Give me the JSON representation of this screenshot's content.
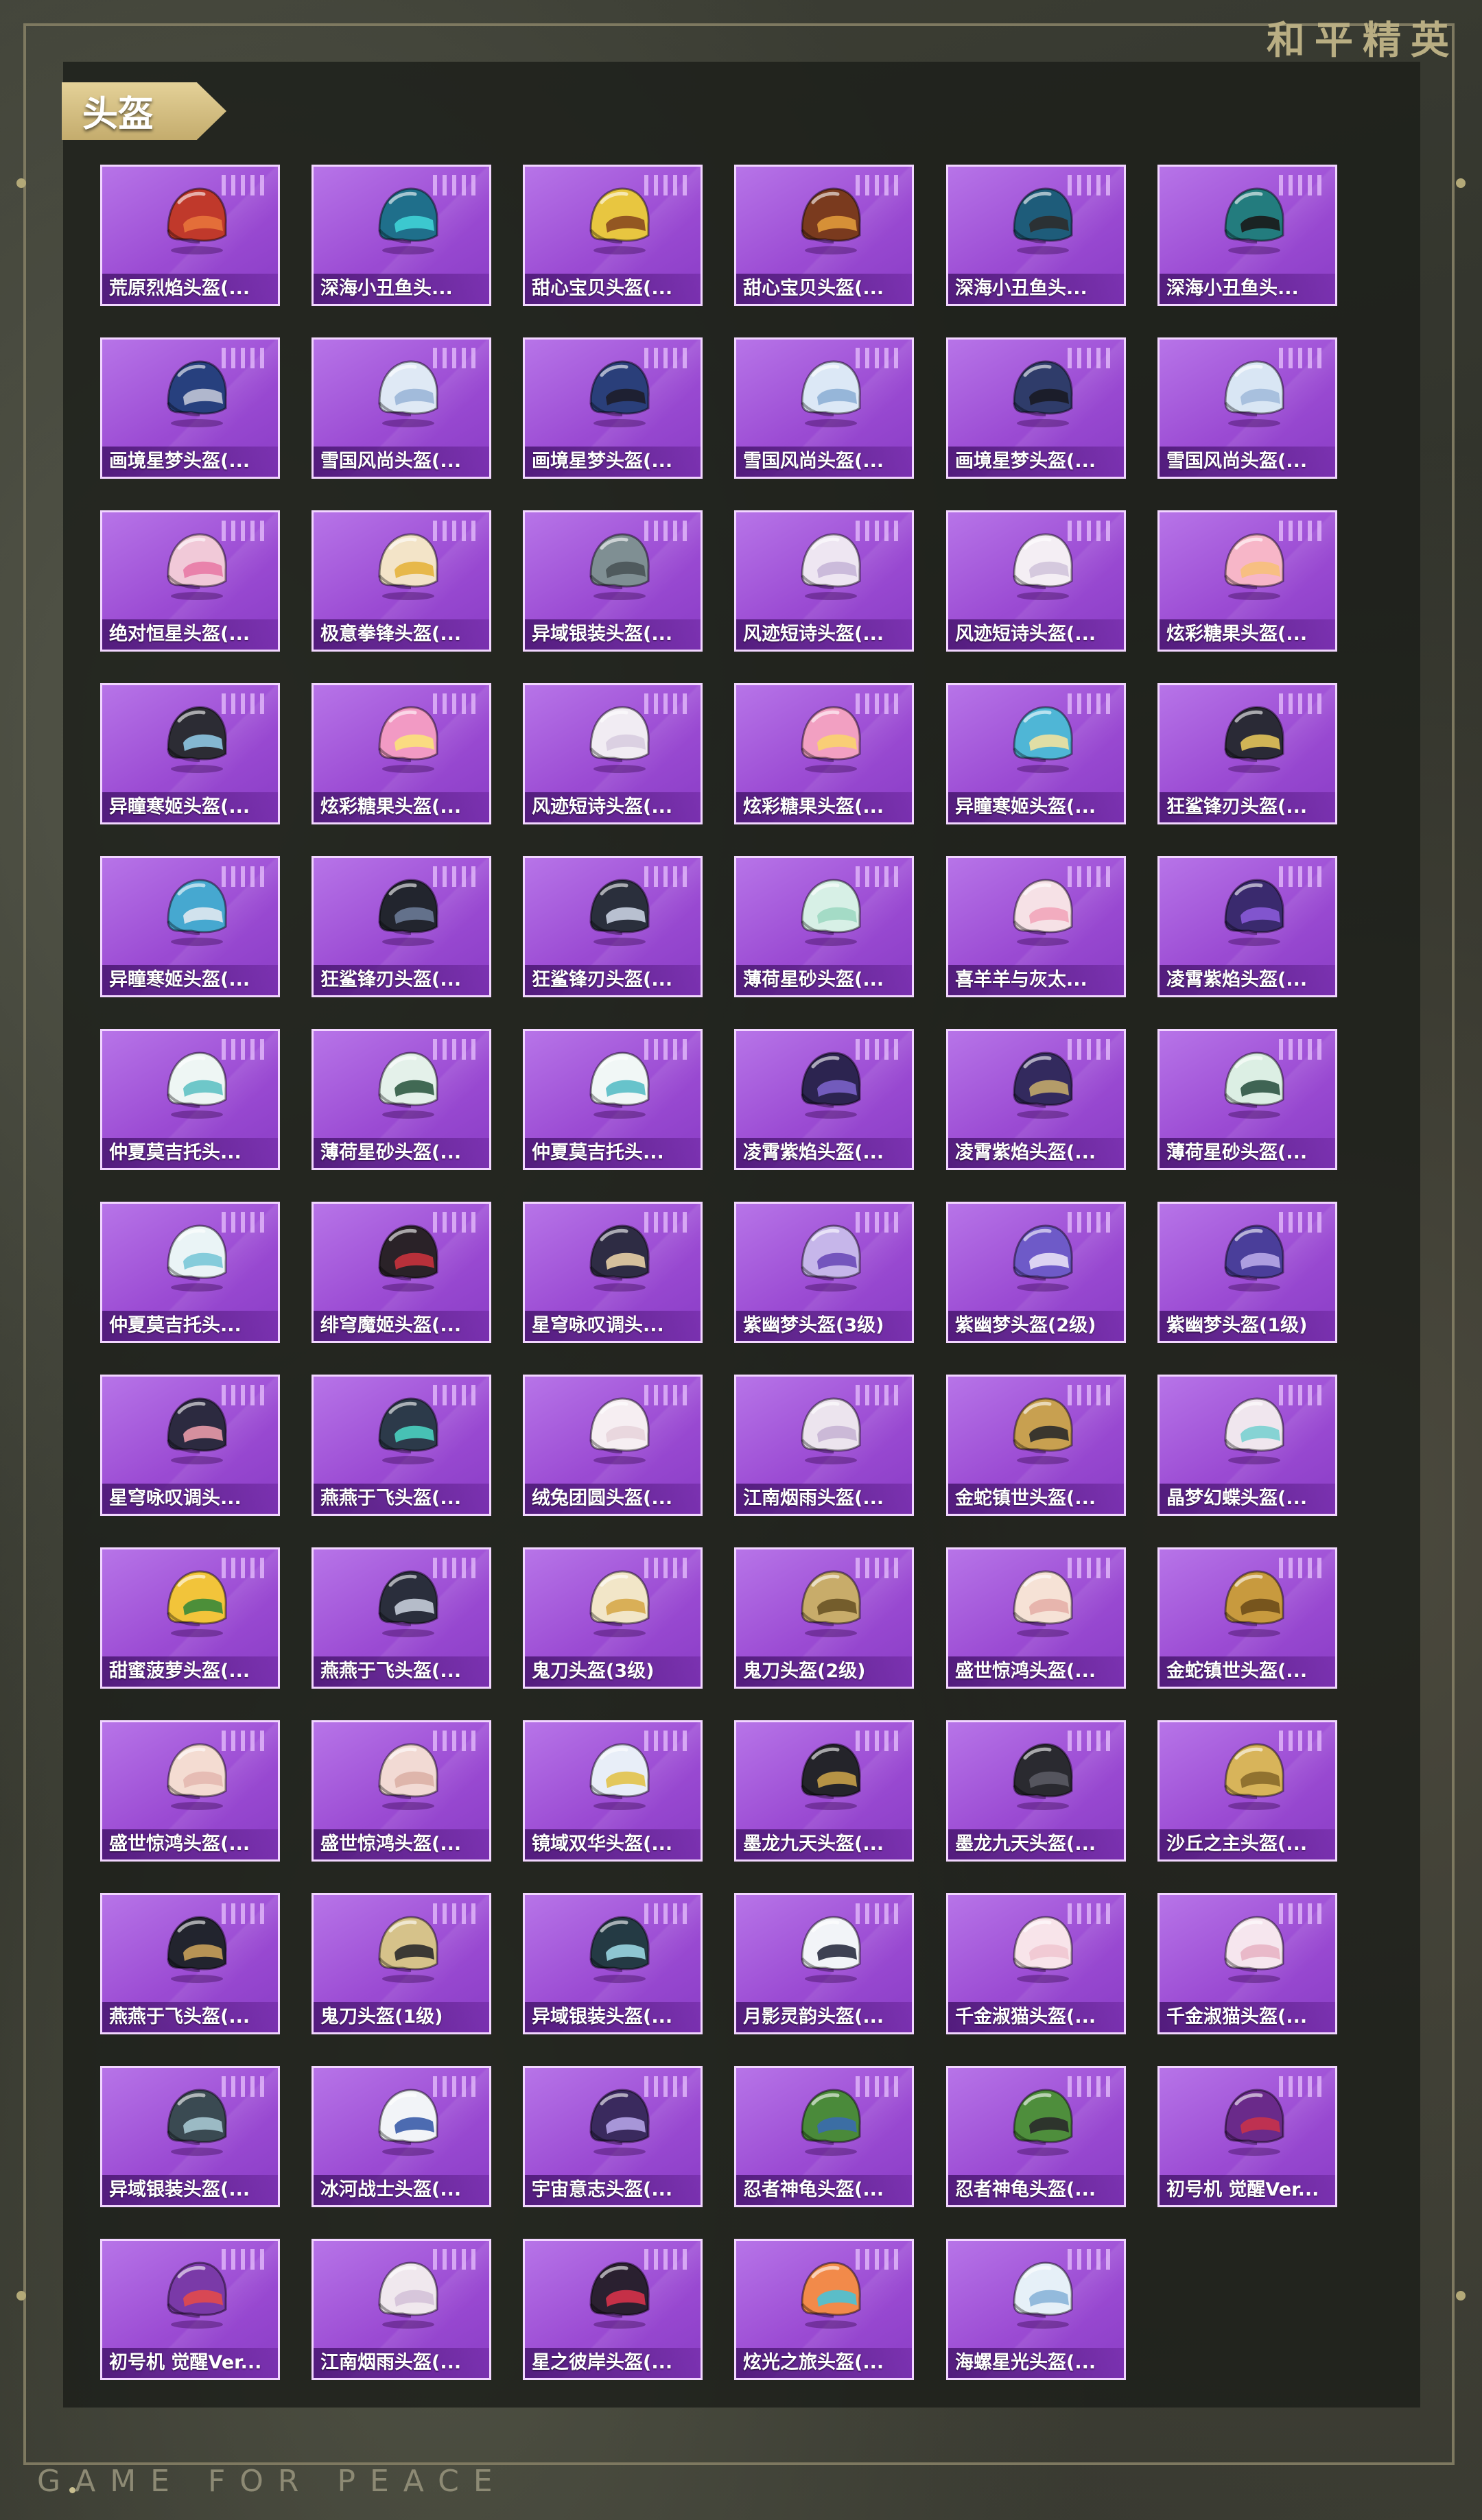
{
  "brand": "和平精英",
  "section_title": "头盔",
  "footer": "GAME FOR PEACE",
  "items": [
    {
      "label": "荒原烈焰头盔(...",
      "color": "#c0392b",
      "accent": "#e8743b",
      "icon": "helmet-icon"
    },
    {
      "label": "深海小丑鱼头...",
      "color": "#1f6f8b",
      "accent": "#3fd1d6",
      "icon": "helmet-icon"
    },
    {
      "label": "甜心宝贝头盔(...",
      "color": "#e8c640",
      "accent": "#8a4a1f",
      "icon": "helmet-icon"
    },
    {
      "label": "甜心宝贝头盔(...",
      "color": "#7a3a1e",
      "accent": "#e09a3a",
      "icon": "helmet-icon"
    },
    {
      "label": "深海小丑鱼头...",
      "color": "#1e5c7a",
      "accent": "#2c2c2c",
      "icon": "helmet-icon"
    },
    {
      "label": "深海小丑鱼头...",
      "color": "#237c7e",
      "accent": "#1a1a1a",
      "icon": "helmet-icon"
    },
    {
      "label": "画境星梦头盔(...",
      "color": "#27407e",
      "accent": "#c0c4d6",
      "icon": "helmet-icon"
    },
    {
      "label": "雪国风尚头盔(...",
      "color": "#dfe9f5",
      "accent": "#9bb6d8",
      "icon": "helmet-icon"
    },
    {
      "label": "画境星梦头盔(...",
      "color": "#2a3f7a",
      "accent": "#1d1d2a",
      "icon": "helmet-icon"
    },
    {
      "label": "雪国风尚头盔(...",
      "color": "#dce8f6",
      "accent": "#8eb0d6",
      "icon": "helmet-icon"
    },
    {
      "label": "画境星梦头盔(...",
      "color": "#2f3c6a",
      "accent": "#1a1a24",
      "icon": "helmet-icon"
    },
    {
      "label": "雪国风尚头盔(...",
      "color": "#d9e6f4",
      "accent": "#a2bbdc",
      "icon": "helmet-icon"
    },
    {
      "label": "绝对恒星头盔(...",
      "color": "#f1c9d8",
      "accent": "#e87aa6",
      "icon": "helmet-icon"
    },
    {
      "label": "极意拳锋头盔(...",
      "color": "#f3e4c8",
      "accent": "#e6b23c",
      "icon": "helmet-icon"
    },
    {
      "label": "异域银装头盔(...",
      "color": "#7f8f93",
      "accent": "#4a5458",
      "icon": "helmet-icon"
    },
    {
      "label": "风迹短诗头盔(...",
      "color": "#eee6f2",
      "accent": "#c6b6d8",
      "icon": "helmet-icon"
    },
    {
      "label": "风迹短诗头盔(...",
      "color": "#f4eef4",
      "accent": "#d2c4dc",
      "icon": "helmet-icon"
    },
    {
      "label": "炫彩糖果头盔(...",
      "color": "#f7b6c8",
      "accent": "#f6c07a",
      "icon": "helmet-icon"
    },
    {
      "label": "异瞳寒姬头盔(...",
      "color": "#2c2c34",
      "accent": "#8ec6e2",
      "icon": "helmet-icon"
    },
    {
      "label": "炫彩糖果头盔(...",
      "color": "#f29ac4",
      "accent": "#fbe27a",
      "icon": "helmet-icon"
    },
    {
      "label": "风迹短诗头盔(...",
      "color": "#f1ecf3",
      "accent": "#d8cde0",
      "icon": "helmet-icon"
    },
    {
      "label": "炫彩糖果头盔(...",
      "color": "#f2a0c2",
      "accent": "#f9d36e",
      "icon": "helmet-icon"
    },
    {
      "label": "异瞳寒姬头盔(...",
      "color": "#4fb6d6",
      "accent": "#f0e2a0",
      "icon": "helmet-icon"
    },
    {
      "label": "狂鲨锋刃头盔(...",
      "color": "#2a2a36",
      "accent": "#e2c35a",
      "icon": "helmet-icon"
    },
    {
      "label": "异瞳寒姬头盔(...",
      "color": "#46a8d0",
      "accent": "#e0e8f0",
      "icon": "helmet-icon"
    },
    {
      "label": "狂鲨锋刃头盔(...",
      "color": "#22252e",
      "accent": "#6a7a96",
      "icon": "helmet-icon"
    },
    {
      "label": "狂鲨锋刃头盔(...",
      "color": "#2a2f3c",
      "accent": "#c8d0e0",
      "icon": "helmet-icon"
    },
    {
      "label": "薄荷星砂头盔(...",
      "color": "#d7f0e6",
      "accent": "#9ed8c2",
      "icon": "helmet-icon"
    },
    {
      "label": "喜羊羊与灰太...",
      "color": "#f6e1e6",
      "accent": "#f2a6ba",
      "icon": "helmet-icon"
    },
    {
      "label": "凌霄紫焰头盔(...",
      "color": "#3a2a6e",
      "accent": "#8a5ad8",
      "icon": "helmet-icon"
    },
    {
      "label": "仲夏莫吉托头...",
      "color": "#eef6f4",
      "accent": "#5fc2c4",
      "icon": "helmet-icon"
    },
    {
      "label": "薄荷星砂头盔(...",
      "color": "#e4f1ea",
      "accent": "#2f5a44",
      "icon": "helmet-icon"
    },
    {
      "label": "仲夏莫吉托头...",
      "color": "#f1f7f6",
      "accent": "#58bcc6",
      "icon": "helmet-icon"
    },
    {
      "label": "凌霄紫焰头盔(...",
      "color": "#2c2450",
      "accent": "#7a62c8",
      "icon": "helmet-icon"
    },
    {
      "label": "凌霄紫焰头盔(...",
      "color": "#332a5e",
      "accent": "#c2a86a",
      "icon": "helmet-icon"
    },
    {
      "label": "薄荷星砂头盔(...",
      "color": "#dcefe4",
      "accent": "#2e5444",
      "icon": "helmet-icon"
    },
    {
      "label": "仲夏莫吉托头...",
      "color": "#eaf4f6",
      "accent": "#7ac8d8",
      "icon": "helmet-icon"
    },
    {
      "label": "绯穹魔姬头盔(...",
      "color": "#2a2228",
      "accent": "#c8323c",
      "icon": "helmet-icon"
    },
    {
      "label": "星穹咏叹调头...",
      "color": "#2e2c44",
      "accent": "#e8cfa6",
      "icon": "helmet-icon"
    },
    {
      "label": "紫幽梦头盔(3级)",
      "color": "#c6b6ea",
      "accent": "#6a4ab8",
      "icon": "helmet-icon"
    },
    {
      "label": "紫幽梦头盔(2级)",
      "color": "#6e5ac8",
      "accent": "#e8e0f6",
      "icon": "helmet-icon"
    },
    {
      "label": "紫幽梦头盔(1级)",
      "color": "#4a3e9a",
      "accent": "#b8a8e8",
      "icon": "helmet-icon"
    },
    {
      "label": "星穹咏叹调头...",
      "color": "#2c2a40",
      "accent": "#e89aa8",
      "icon": "helmet-icon"
    },
    {
      "label": "燕燕于飞头盔(...",
      "color": "#2c3a4a",
      "accent": "#4ad0c0",
      "icon": "helmet-icon"
    },
    {
      "label": "绒兔团圆头盔(...",
      "color": "#f6eef2",
      "accent": "#e8d4dc",
      "icon": "helmet-icon"
    },
    {
      "label": "江南烟雨头盔(...",
      "color": "#ece4ee",
      "accent": "#c8b4d4",
      "icon": "helmet-icon"
    },
    {
      "label": "金蛇镇世头盔(...",
      "color": "#c8a050",
      "accent": "#2a2a2a",
      "icon": "helmet-icon"
    },
    {
      "label": "晶梦幻蝶头盔(...",
      "color": "#f0e6ee",
      "accent": "#7ad0d0",
      "icon": "helmet-icon"
    },
    {
      "label": "甜蜜菠萝头盔(...",
      "color": "#f2c43a",
      "accent": "#3a8a3a",
      "icon": "helmet-icon"
    },
    {
      "label": "燕燕于飞头盔(...",
      "color": "#2a2e3c",
      "accent": "#c4ccd8",
      "icon": "helmet-icon"
    },
    {
      "label": "鬼刀头盔(3级)",
      "color": "#f2e6c8",
      "accent": "#d6a84a",
      "icon": "helmet-icon"
    },
    {
      "label": "鬼刀头盔(2级)",
      "color": "#c8ac6a",
      "accent": "#6a5426",
      "icon": "helmet-icon"
    },
    {
      "label": "盛世惊鸿头盔(...",
      "color": "#f6e2d6",
      "accent": "#e6b0a8",
      "icon": "helmet-icon"
    },
    {
      "label": "金蛇镇世头盔(...",
      "color": "#c89a3e",
      "accent": "#6e4e1a",
      "icon": "helmet-icon"
    },
    {
      "label": "盛世惊鸿头盔(...",
      "color": "#f4dcd2",
      "accent": "#e4b8b0",
      "icon": "helmet-icon"
    },
    {
      "label": "盛世惊鸿头盔(...",
      "color": "#f2dad4",
      "accent": "#dcb0a6",
      "icon": "helmet-icon"
    },
    {
      "label": "镜域双华头盔(...",
      "color": "#e8eef8",
      "accent": "#e2c24a",
      "icon": "helmet-icon"
    },
    {
      "label": "墨龙九天头盔(...",
      "color": "#24242a",
      "accent": "#c6a048",
      "icon": "helmet-icon"
    },
    {
      "label": "墨龙九天头盔(...",
      "color": "#2a2a30",
      "accent": "#5a5a64",
      "icon": "helmet-icon"
    },
    {
      "label": "沙丘之主头盔(...",
      "color": "#d8b45a",
      "accent": "#8a6a2a",
      "icon": "helmet-icon"
    },
    {
      "label": "燕燕于飞头盔(...",
      "color": "#22242e",
      "accent": "#c8a05a",
      "icon": "helmet-icon"
    },
    {
      "label": "鬼刀头盔(1级)",
      "color": "#d6c28a",
      "accent": "#2a2a2a",
      "icon": "helmet-icon"
    },
    {
      "label": "异域银装头盔(...",
      "color": "#243a44",
      "accent": "#9ad6e2",
      "icon": "helmet-icon"
    },
    {
      "label": "月影灵韵头盔(...",
      "color": "#f2f4f8",
      "accent": "#2a2e40",
      "icon": "helmet-icon"
    },
    {
      "label": "千金淑猫头盔(...",
      "color": "#f8e4ea",
      "accent": "#f0c6d2",
      "icon": "helmet-icon"
    },
    {
      "label": "千金淑猫头盔(...",
      "color": "#f6e6ee",
      "accent": "#e8b4c4",
      "icon": "helmet-icon"
    },
    {
      "label": "异域银装头盔(...",
      "color": "#3a4a52",
      "accent": "#a6c6d0",
      "icon": "helmet-icon"
    },
    {
      "label": "冰河战士头盔(...",
      "color": "#f2f4f8",
      "accent": "#3a5ca8",
      "icon": "helmet-icon"
    },
    {
      "label": "宇宙意志头盔(...",
      "color": "#3a2a5e",
      "accent": "#b4a2e6",
      "icon": "helmet-icon"
    },
    {
      "label": "忍者神龟头盔(...",
      "color": "#4a8a3a",
      "accent": "#3a6ab0",
      "icon": "helmet-icon"
    },
    {
      "label": "忍者神龟头盔(...",
      "color": "#4e8e3c",
      "accent": "#2a2a2a",
      "icon": "helmet-icon"
    },
    {
      "label": "初号机 觉醒Ver...",
      "color": "#6a2a8a",
      "accent": "#c8324a",
      "icon": "helmet-icon"
    },
    {
      "label": "初号机 觉醒Ver...",
      "color": "#7a3aa8",
      "accent": "#e24a4a",
      "icon": "helmet-icon"
    },
    {
      "label": "江南烟雨头盔(...",
      "color": "#f0e8ee",
      "accent": "#d4c2d8",
      "icon": "helmet-icon"
    },
    {
      "label": "星之彼岸头盔(...",
      "color": "#2a2030",
      "accent": "#d6324a",
      "icon": "helmet-icon"
    },
    {
      "label": "炫光之旅头盔(...",
      "color": "#f28a4a",
      "accent": "#4ac2d6",
      "icon": "helmet-icon"
    },
    {
      "label": "海螺星光头盔(...",
      "color": "#e6f0f8",
      "accent": "#8ab4d8",
      "icon": "helmet-icon"
    }
  ]
}
